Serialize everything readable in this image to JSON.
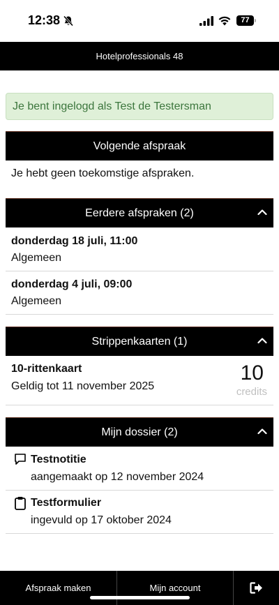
{
  "status_bar": {
    "time": "12:38",
    "battery": "77",
    "icons": [
      "bell-off-icon",
      "signal-icon",
      "wifi-icon",
      "battery-icon"
    ]
  },
  "header": {
    "title": "Hotelprofessionals 48"
  },
  "alert": {
    "text": "Je bent ingelogd als Test de Testersman",
    "color": "#3c763d",
    "background": "#dff0d8"
  },
  "sections": {
    "upcoming": {
      "title": "Volgende afspraak",
      "empty_text": "Je hebt geen toekomstige afspraken."
    },
    "past": {
      "title": "Eerdere afspraken (2)",
      "items": [
        {
          "date": "donderdag 18 juli, 11:00",
          "type": "Algemeen"
        },
        {
          "date": "donderdag 4 juli, 09:00",
          "type": "Algemeen"
        }
      ]
    },
    "cards": {
      "title": "Strippenkaarten (1)",
      "items": [
        {
          "name": "10-rittenkaart",
          "valid": "Geldig tot 11 november 2025",
          "count": "10",
          "unit": "credits"
        }
      ]
    },
    "dossier": {
      "title": "Mijn dossier (2)",
      "items": [
        {
          "icon": "comment-icon",
          "name": "Testnotitie",
          "detail": "aangemaakt op 12 november 2024"
        },
        {
          "icon": "clipboard-icon",
          "name": "Testformulier",
          "detail": "ingevuld op 17 oktober 2024"
        }
      ]
    }
  },
  "bottom_nav": {
    "appointment": "Afspraak maken",
    "account": "Mijn account",
    "logout_icon": "logout-icon"
  }
}
